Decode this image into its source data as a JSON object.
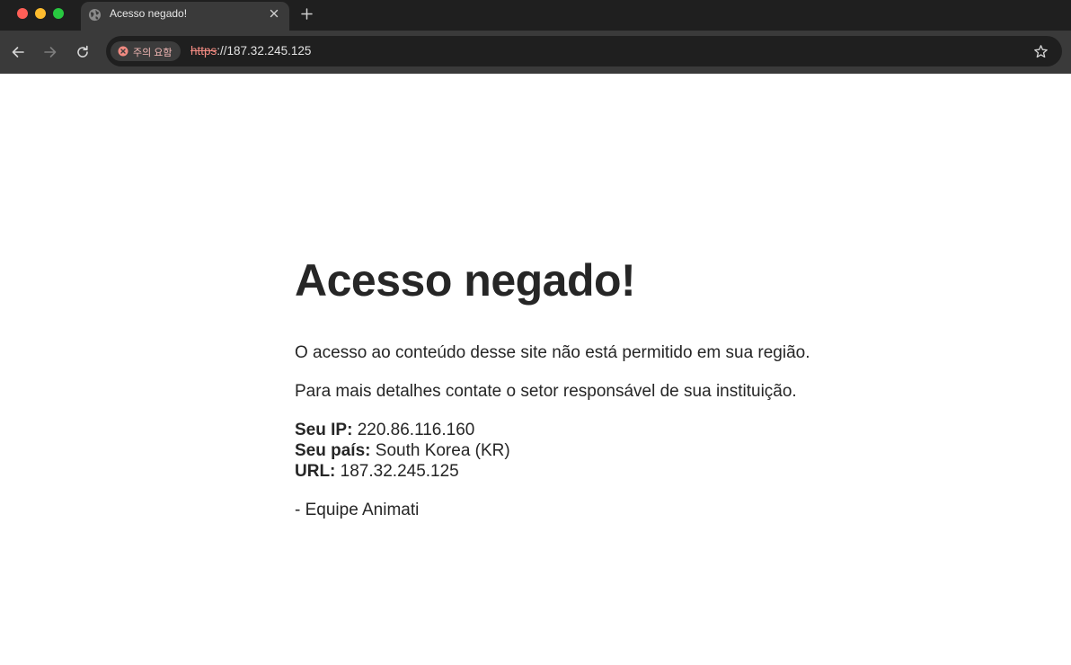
{
  "browser": {
    "tab": {
      "title": "Acesso negado!",
      "icon": "globe-icon"
    },
    "security_chip": {
      "label": "주의 요함",
      "icon": "warning-x-icon",
      "color": "#f2b8b5"
    },
    "address": {
      "scheme": "https",
      "rest": "://187.32.245.125"
    }
  },
  "page": {
    "heading": "Acesso negado!",
    "paragraph1": "O acesso ao conteúdo desse site não está permitido em sua região.",
    "paragraph2": "Para mais detalhes contate o setor responsável de sua instituição.",
    "details": {
      "ip_label": "Seu IP:",
      "ip_value": "220.86.116.160",
      "country_label": "Seu país:",
      "country_value": "South Korea (KR)",
      "url_label": "URL:",
      "url_value": "187.32.245.125"
    },
    "signature": "- Equipe Animati"
  }
}
